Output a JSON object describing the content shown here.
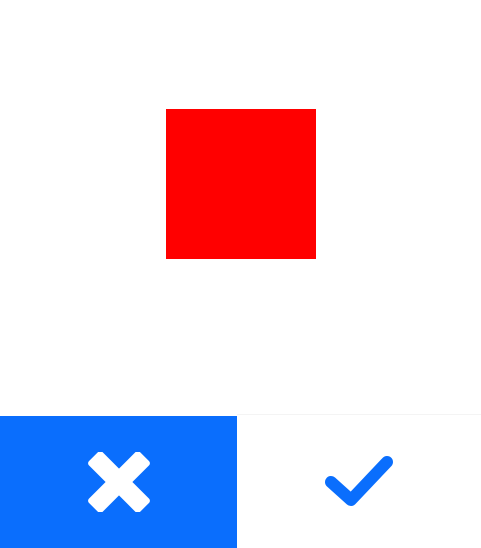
{
  "target": {
    "shape": "square",
    "color": "#ff0000"
  },
  "actions": {
    "reject": {
      "icon": "close-icon",
      "background": "#0a6efd",
      "icon_color": "#ffffff"
    },
    "accept": {
      "icon": "checkmark-icon",
      "background": "#ffffff",
      "icon_color": "#0a6efd"
    }
  }
}
